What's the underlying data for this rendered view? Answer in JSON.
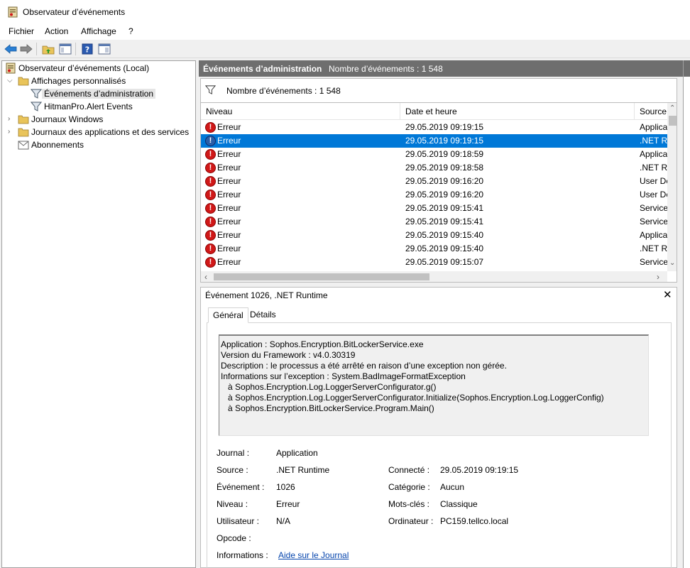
{
  "window": {
    "title": "Observateur d’événements"
  },
  "menu": [
    "Fichier",
    "Action",
    "Affichage",
    "?"
  ],
  "tree": {
    "root": "Observateur d’événements (Local)",
    "custom_views": "Affichages personnalisés",
    "admin_events": "Événements d’administration",
    "hitmanpro": "HitmanPro.Alert Events",
    "windows_logs": "Journaux Windows",
    "app_service_logs": "Journaux des applications et des services",
    "subscriptions": "Abonnements"
  },
  "center": {
    "header_title": "Événements d’administration",
    "header_count": "Nombre d’événements : 1 548",
    "filter_text": "Nombre d’événements : 1 548"
  },
  "grid": {
    "columns": [
      "Niveau",
      "Date et heure",
      "Source"
    ],
    "rows": [
      {
        "level": "Erreur",
        "date": "29.05.2019 09:19:15",
        "source": "Applicati"
      },
      {
        "level": "Erreur",
        "date": "29.05.2019 09:19:15",
        "source": ".NET Ru"
      },
      {
        "level": "Erreur",
        "date": "29.05.2019 09:18:59",
        "source": "Applicati"
      },
      {
        "level": "Erreur",
        "date": "29.05.2019 09:18:58",
        "source": ".NET Ru"
      },
      {
        "level": "Erreur",
        "date": "29.05.2019 09:16:20",
        "source": "User De"
      },
      {
        "level": "Erreur",
        "date": "29.05.2019 09:16:20",
        "source": "User De"
      },
      {
        "level": "Erreur",
        "date": "29.05.2019 09:15:41",
        "source": "Service"
      },
      {
        "level": "Erreur",
        "date": "29.05.2019 09:15:41",
        "source": "Service"
      },
      {
        "level": "Erreur",
        "date": "29.05.2019 09:15:40",
        "source": "Applicati"
      },
      {
        "level": "Erreur",
        "date": "29.05.2019 09:15:40",
        "source": ".NET Ru"
      },
      {
        "level": "Erreur",
        "date": "29.05.2019 09:15:07",
        "source": "Service"
      }
    ]
  },
  "detail": {
    "title": "Événement 1026, .NET Runtime",
    "tabs": [
      "Général",
      "Détails"
    ],
    "description": [
      "Application : Sophos.Encryption.BitLockerService.exe",
      "Version du Framework : v4.0.30319",
      "Description : le processus a été arrêté en raison d’une exception non gérée.",
      "Informations sur l’exception : System.BadImageFormatException",
      "   à Sophos.Encryption.Log.LoggerServerConfigurator.g()",
      "   à Sophos.Encryption.Log.LoggerServerConfigurator.Initialize(Sophos.Encryption.Log.LoggerConfig)",
      "   à Sophos.Encryption.BitLockerService.Program.Main()"
    ],
    "props": {
      "journal_label": "Journal :",
      "journal_value": "Application",
      "source_label": "Source :",
      "source_value": ".NET Runtime",
      "connecte_label": "Connecté :",
      "connecte_value": "29.05.2019 09:19:15",
      "evenement_label": "Événement :",
      "evenement_value": "1026",
      "categorie_label": "Catégorie :",
      "categorie_value": "Aucun",
      "niveau_label": "Niveau :",
      "niveau_value": "Erreur",
      "motscles_label": "Mots-clés :",
      "motscles_value": "Classique",
      "utilisateur_label": "Utilisateur :",
      "utilisateur_value": "N/A",
      "ordinateur_label": "Ordinateur :",
      "ordinateur_value": "PC159.tellco.local",
      "opcode_label": "Opcode :",
      "informations_label": "Informations :",
      "informations_link": "Aide sur le Journal"
    }
  },
  "colors": {
    "selection": "#0078d7",
    "header": "#6e6e6e",
    "error": "#d01818"
  }
}
